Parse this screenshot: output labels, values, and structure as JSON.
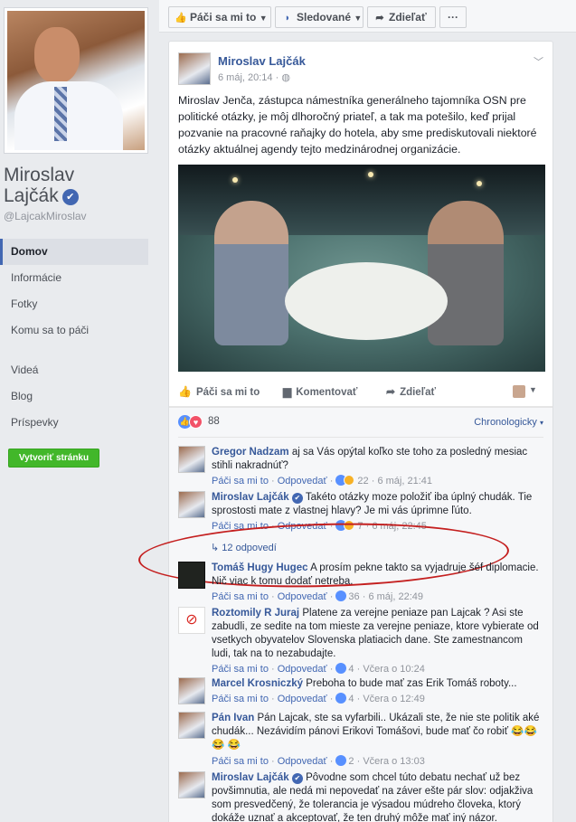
{
  "page": {
    "name_line1": "Miroslav",
    "name_line2": "Lajčák",
    "handle": "@LajcakMiroslav"
  },
  "nav": {
    "items": [
      "Domov",
      "Informácie",
      "Fotky",
      "Komu sa to páči",
      "Videá",
      "Blog",
      "Príspevky"
    ],
    "active_index": 0
  },
  "create_page_label": "Vytvoriť stránku",
  "topbar": {
    "like": "Páči sa mi to",
    "follow": "Sledované",
    "share": "Zdieľať",
    "more": "···"
  },
  "post": {
    "author": "Miroslav Lajčák",
    "time": "6 máj, 20:14",
    "text": "Miroslav Jenča, zástupca námestníka generálneho tajomníka OSN pre politické otázky, je môj dlhoročný priateľ, a tak ma potešilo, keď prijal pozvanie na pracovné raňajky do hotela, aby sme prediskutovali niektoré otázky aktuálnej agendy tejto medzinárodnej organizácie.",
    "actions": {
      "like": "Páči sa mi to",
      "comment": "Komentovať",
      "share": "Zdieľať"
    },
    "reaction_count": "88",
    "sort_label": "Chronologicky"
  },
  "comments": [
    {
      "author": "Gregor Nadzam",
      "text": "aj sa Vás opýtal koľko ste toho za posledný mesiac stihli nakradnúť?",
      "like": "Páči sa mi to",
      "reply": "Odpovedať",
      "count": "22",
      "time": "6 máj, 21:41"
    },
    {
      "author": "Miroslav Lajčák",
      "text": "Takéto otázky moze položiť iba úplný chudák. Tie sprostosti mate z vlastnej hlavy? Je mi vás úprimne ľúto.",
      "like": "Páči sa mi to",
      "reply": "Odpovedať",
      "count": "7",
      "time": "6 máj, 22:45",
      "replies": "12 odpovedí"
    },
    {
      "author": "Tomáš Hugy Hugec",
      "text": "A prosím pekne takto sa vyjadruje šéf diplomacie. Nič viac k tomu dodať netreba.",
      "like": "Páči sa mi to",
      "reply": "Odpovedať",
      "count": "36",
      "time": "6 máj, 22:49"
    },
    {
      "author": "Roztomily R Juraj",
      "text": "Platene za verejne peniaze pan Lajcak ? Asi ste zabudli, ze sedite na tom mieste za verejne peniaze, ktore vybierate od vsetkych obyvatelov Slovenska platiacich dane. Ste zamestnancom ludi, tak na to nezabudajte.",
      "like": "Páči sa mi to",
      "reply": "Odpovedať",
      "count": "4",
      "time": "Včera o 10:24"
    },
    {
      "author": "Marcel Krosniczký",
      "text": "Preboha to bude mať zas Erik Tomáš roboty...",
      "like": "Páči sa mi to",
      "reply": "Odpovedať",
      "count": "4",
      "time": "Včera o 12:49"
    },
    {
      "author": "Pán Ivan",
      "text": "Pán Lajcak, ste sa vyfarbili.. Ukázali ste, že nie ste politik aké chudák... Nezávidím pánovi Erikovi Tomášovi, bude mať čo robiť 😂😂😂 😂",
      "like": "Páči sa mi to",
      "reply": "Odpovedať",
      "count": "2",
      "time": "Včera o 13:03"
    },
    {
      "author": "Miroslav Lajčák",
      "text": "Pôvodne som chcel túto debatu nechať už bez povšimnutia, ale nedá mi nepovedať na záver ešte pár slov: odjakživa som presvedčený, že tolerancia je výsadou múdreho človeka, ktorý dokáže uznať a akceptovať, že ten druhý môže mať iný názor. Rešpektujem názory",
      "like": "",
      "reply": "",
      "count": "",
      "time": ""
    }
  ],
  "colors": {
    "brand": "#4267b2",
    "link": "#365899",
    "create_button": "#42b72a",
    "highlight_oval": "#c41f1f"
  },
  "icons": [
    "thumbs-up-icon",
    "rss-icon",
    "share-arrow-icon",
    "more-icon",
    "globe-icon",
    "chevron-down-icon",
    "comment-icon",
    "verified-badge-icon",
    "like-reaction-icon",
    "love-reaction-icon",
    "haha-reaction-icon"
  ]
}
